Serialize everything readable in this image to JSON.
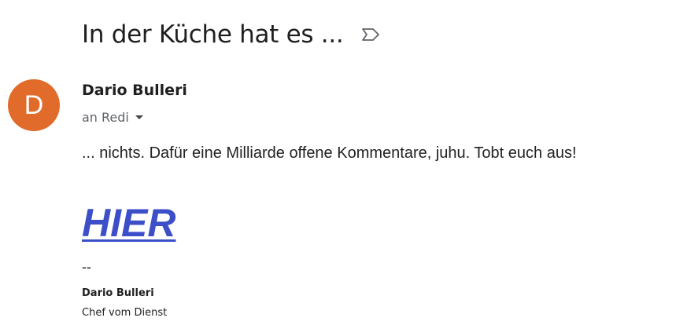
{
  "email": {
    "subject": "In der Küche hat es ...",
    "label_icon": "label-icon",
    "sender": {
      "initial": "D",
      "name": "Dario Bulleri",
      "avatar_color": "#e06b2b",
      "recipients": "an Redi"
    },
    "body": {
      "text": "... nichts. Dafür eine Milliarde offene Kommentare, juhu. Tobt euch aus!",
      "link_text": "HIER",
      "link_color": "#3c4fc9"
    },
    "signature": {
      "separator": "--",
      "name": "Dario Bulleri",
      "role": "Chef vom Dienst"
    }
  }
}
